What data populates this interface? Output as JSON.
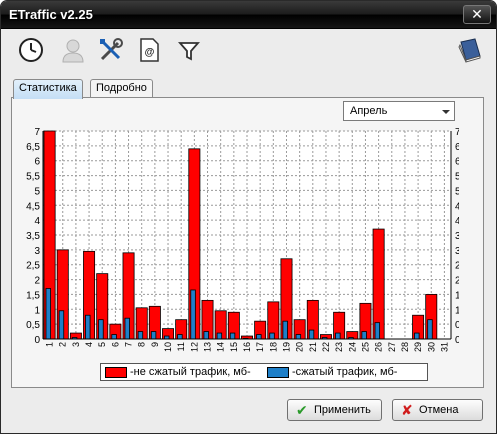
{
  "window": {
    "title": "ETraffic  v2.25",
    "close_symbol": "✕"
  },
  "toolbar": {
    "tools": [
      {
        "name": "clock-icon"
      },
      {
        "name": "user-icon"
      },
      {
        "name": "settings-tools-icon"
      },
      {
        "name": "email-icon"
      },
      {
        "name": "filter-icon"
      },
      {
        "name": "book-icon"
      }
    ]
  },
  "tabs": [
    {
      "label": "Статистика",
      "active": true
    },
    {
      "label": "Подробно",
      "active": false
    }
  ],
  "month_select": {
    "value": "Апрель"
  },
  "chart_data": {
    "type": "bar",
    "categories": [
      "1",
      "2",
      "3",
      "4",
      "5",
      "6",
      "7",
      "8",
      "9",
      "10",
      "11",
      "12",
      "13",
      "14",
      "15",
      "16",
      "17",
      "18",
      "19",
      "20",
      "21",
      "22",
      "23",
      "24",
      "25",
      "26",
      "27",
      "28",
      "29",
      "30",
      "31"
    ],
    "series": [
      {
        "name": "-не сжатый трафик, мб-",
        "color": "#ff0000",
        "values": [
          7.0,
          3.0,
          0.2,
          2.95,
          2.2,
          0.5,
          2.9,
          1.05,
          1.1,
          0.35,
          0.65,
          6.4,
          1.3,
          0.95,
          0.9,
          0.1,
          0.6,
          1.25,
          2.7,
          0.65,
          1.3,
          0.15,
          0.9,
          0.25,
          1.2,
          3.7,
          0,
          0,
          0.8,
          1.5,
          0
        ]
      },
      {
        "name": "-сжатый трафик, мб-",
        "color": "#1e7fc8",
        "values": [
          1.7,
          0.95,
          0.05,
          0.8,
          0.65,
          0.15,
          0.7,
          0.25,
          0.25,
          0.1,
          0.15,
          1.65,
          0.25,
          0.2,
          0.2,
          0.02,
          0.15,
          0.2,
          0.6,
          0.15,
          0.3,
          0.05,
          0.2,
          0.05,
          0.25,
          0.55,
          0,
          0,
          0.2,
          0.65,
          0
        ]
      }
    ],
    "yticks": [
      "0",
      "0,5",
      "1",
      "1,5",
      "2",
      "2,5",
      "3",
      "3,5",
      "4",
      "4,5",
      "5",
      "5,5",
      "6",
      "6,5",
      "7"
    ],
    "ylim": [
      0,
      7
    ],
    "grid": true,
    "legend": "bottom-center"
  },
  "buttons": {
    "apply": {
      "label": "Применить",
      "icon": "✔",
      "color": "#2a9a2a"
    },
    "cancel": {
      "label": "Отмена",
      "icon": "✘",
      "color": "#d01c1c"
    }
  }
}
